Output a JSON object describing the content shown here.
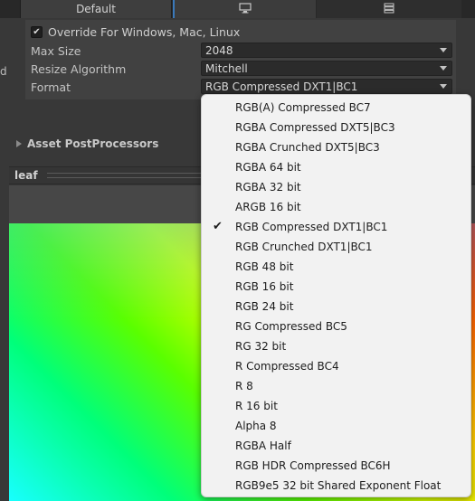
{
  "tabs": {
    "default_label": "Default",
    "pc_icon": "monitor-icon",
    "server_icon": "server-icon"
  },
  "left_cut_text": "d",
  "override": {
    "checked": true,
    "label": "Override For Windows, Mac, Linux"
  },
  "settings": {
    "max_size": {
      "label": "Max Size",
      "value": "2048"
    },
    "resize_algorithm": {
      "label": "Resize Algorithm",
      "value": "Mitchell"
    },
    "format": {
      "label": "Format",
      "value": "RGB Compressed DXT1|BC1"
    }
  },
  "asset_postprocessors": "Asset PostProcessors",
  "preview": {
    "title": "leaf"
  },
  "format_options": {
    "selected_index": 6,
    "items": [
      "RGB(A) Compressed BC7",
      "RGBA Compressed DXT5|BC3",
      "RGBA Crunched DXT5|BC3",
      "RGBA 64 bit",
      "RGBA 32 bit",
      "ARGB 16 bit",
      "RGB Compressed DXT1|BC1",
      "RGB Crunched DXT1|BC1",
      "RGB 48 bit",
      "RGB 16 bit",
      "RGB 24 bit",
      "RG Compressed BC5",
      "RG 32 bit",
      "R Compressed BC4",
      "R 8",
      "R 16 bit",
      "Alpha 8",
      "RGBA Half",
      "RGB HDR Compressed BC6H",
      "RGB9e5 32 bit Shared Exponent Float"
    ]
  }
}
